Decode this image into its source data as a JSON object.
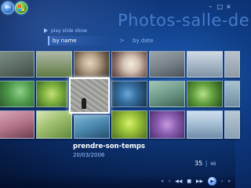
{
  "window": {
    "title": "Photos-salle-de"
  },
  "header": {
    "back_icon": "back-arrow-icon",
    "start_icon": "windows-logo-icon",
    "controls": [
      "–",
      "□",
      "×"
    ]
  },
  "nav": {
    "slideshow_label": "play slide show",
    "sort_by_name": "by name",
    "sort_separator": ">",
    "sort_by_date": "by date"
  },
  "gallery": {
    "focused_index": 13,
    "thumbnail_count": 20
  },
  "caption": {
    "title": "prendre-son-temps",
    "date": "20/03/2006"
  },
  "counter": {
    "current": "35",
    "separator": "|",
    "total": "46"
  },
  "transport": {
    "buttons": [
      "«",
      "‹",
      "◀◀",
      "■",
      "▶▶",
      "▶",
      "›",
      "»"
    ],
    "play_icon": "play-icon"
  },
  "colors": {
    "background": "#0f3d86",
    "accent": "#4f86d6",
    "text_secondary": "#9fc3ff"
  }
}
